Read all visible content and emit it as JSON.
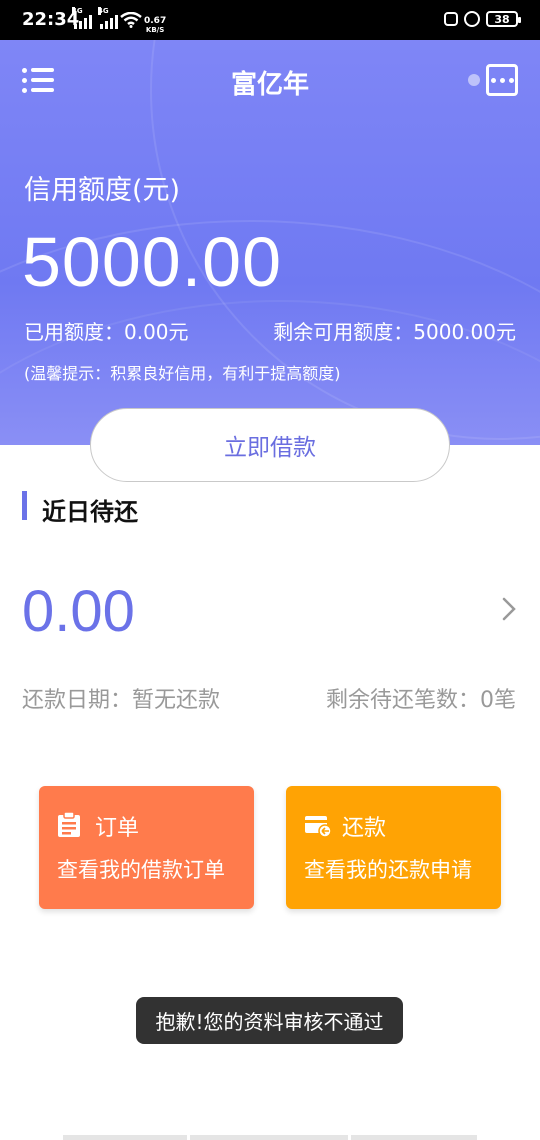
{
  "status_bar": {
    "time": "22:34",
    "network_tag_1": "4G",
    "network_tag_2": "4G",
    "speed_value": "0.67",
    "speed_unit": "KB/S",
    "battery": "38"
  },
  "nav": {
    "title": "富亿年"
  },
  "credit": {
    "label": "信用额度(元)",
    "amount": "5000.00",
    "used": "已用额度：0.00元",
    "remaining": "剩余可用额度：5000.00元",
    "tip": "(温馨提示：积累良好信用，有利于提高额度)"
  },
  "borrow_button": {
    "label": "立即借款"
  },
  "repayment": {
    "section_title": "近日待还",
    "amount": "0.00",
    "date_text": "还款日期：暂无还款",
    "count_text": "剩余待还笔数：0笔"
  },
  "cards": {
    "order": {
      "title": "订单",
      "desc": "查看我的借款订单"
    },
    "repay": {
      "title": "还款",
      "desc": "查看我的还款申请"
    }
  },
  "toast": {
    "message": "抱歉!您的资料审核不通过"
  },
  "colors": {
    "hero": "#7b82f4",
    "accent": "#6b72e8",
    "order_card": "#ff7b4c",
    "repay_card": "#ffa304"
  }
}
